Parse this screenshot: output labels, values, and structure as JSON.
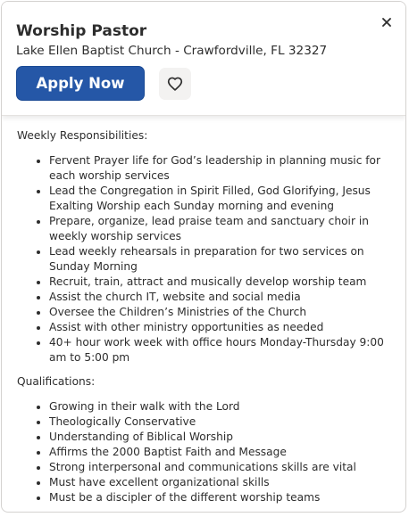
{
  "header": {
    "title": "Worship Pastor",
    "company_location": "Lake Ellen Baptist Church - Crawfordville, FL 32327",
    "apply_label": "Apply Now",
    "close_glyph": "×",
    "close_icon": "close-icon",
    "save_icon": "heart-outline-icon",
    "accent_color": "#2557a7"
  },
  "description": {
    "responsibilities_heading": "Weekly Responsibilities:",
    "responsibilities": [
      "Fervent Prayer life for God’s leadership in planning music for each worship services",
      "Lead the Congregation in Spirit Filled, God Glorifying, Jesus Exalting Worship each Sunday morning and evening",
      "Prepare, organize, lead praise team and sanctuary choir in weekly worship services",
      "Lead weekly rehearsals in preparation for two services on Sunday Morning",
      "Recruit, train, attract and musically develop worship team",
      "Assist the church IT, website and social media",
      "Oversee the Children’s Ministries of the Church",
      "Assist with other ministry opportunities as needed",
      "40+ hour work week with office hours Monday-Thursday 9:00 am to 5:00 pm"
    ],
    "qualifications_heading": "Qualifications:",
    "qualifications": [
      "Growing in their walk with the Lord",
      "Theologically Conservative",
      "Understanding of Biblical Worship",
      "Affirms the 2000 Baptist Faith and Message",
      "Strong interpersonal and communications skills are vital",
      "Must have excellent organizational skills",
      "Must be a discipler of the different worship teams"
    ]
  }
}
